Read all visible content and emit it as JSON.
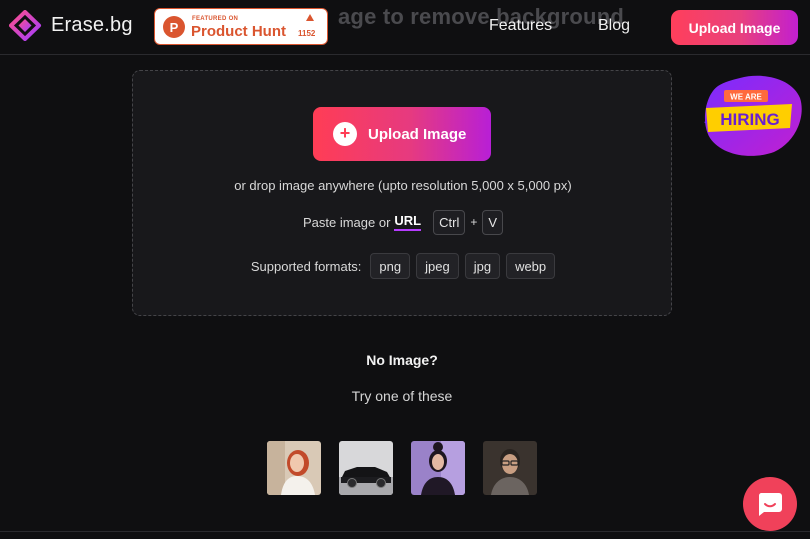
{
  "header": {
    "logo_text": "Erase.bg",
    "ghost_heading": "age to remove background",
    "product_hunt": {
      "featured_label": "FEATURED ON",
      "name": "Product Hunt",
      "upvotes": "1152"
    },
    "nav": [
      {
        "label": "Features"
      },
      {
        "label": "Blog"
      }
    ],
    "upload_button": "Upload Image"
  },
  "upload_card": {
    "button_label": "Upload Image",
    "drop_text": "or drop image anywhere (upto resolution 5,000 x 5,000 px)",
    "paste_prefix": "Paste image or",
    "url_label": "URL",
    "shortcut_key1": "Ctrl",
    "shortcut_plus": "+",
    "shortcut_key2": "V",
    "formats_label": "Supported formats:",
    "formats": [
      "png",
      "jpeg",
      "jpg",
      "webp"
    ]
  },
  "hiring_badge": {
    "line1": "WE ARE",
    "line2": "HIRING"
  },
  "samples": {
    "title": "No Image?",
    "subtitle": "Try one of these",
    "items": [
      "sample-woman-portrait",
      "sample-black-car",
      "sample-woman-purple",
      "sample-man-glasses"
    ]
  },
  "colors": {
    "accent_start": "#ff3d55",
    "accent_end": "#b81fd6",
    "background": "#0f0f11",
    "card": "#18181b",
    "product_hunt": "#da552f"
  }
}
